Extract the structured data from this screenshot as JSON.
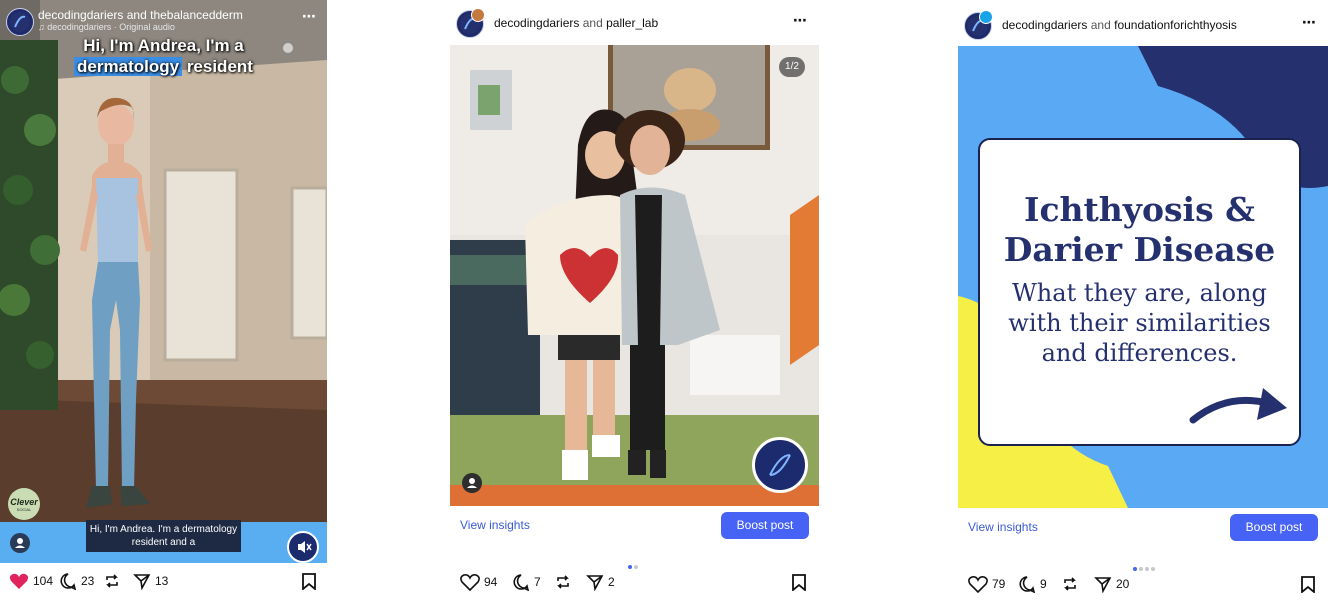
{
  "posts": [
    {
      "author": "decodingdariers",
      "conj": "and",
      "collaborator": "thebalancedderm",
      "audio": "decodingdariers · Original audio",
      "caption_line1": "Hi, I'm Andrea, I'm a",
      "caption_highlight": "dermatology",
      "caption_line2_rest": "resident",
      "subtitle": "Hi, I'm Andrea. I'm a dermatology resident and a",
      "sticker_text": "Clever",
      "sticker_sub": "SOCIAL",
      "likes": "104",
      "comments": "23",
      "shares": "13",
      "liked": true
    },
    {
      "author": "decodingdariers",
      "conj": "and",
      "collaborator": "paller_lab",
      "counter": "1/2",
      "view_insights": "View insights",
      "boost": "Boost post",
      "likes": "94",
      "comments": "7",
      "shares": "2"
    },
    {
      "author": "decodingdariers",
      "conj": "and",
      "collaborator": "foundationforichthyosis",
      "card_title_line1": "Ichthyosis &",
      "card_title_line2": "Darier Disease",
      "card_body_line1": "What they are, along",
      "card_body_line2": "with their similarities",
      "card_body_line3": "and differences.",
      "view_insights": "View insights",
      "boost": "Boost post",
      "likes": "79",
      "comments": "9",
      "shares": "20"
    }
  ],
  "icons": {
    "more": "⋯",
    "music": "♫"
  },
  "colors": {
    "accent": "#4763f5",
    "link": "#3b5bd6",
    "like_red": "#e0245e",
    "navy": "#25306e",
    "card_blue": "#5aa9f5",
    "card_yellow": "#f6ef45"
  }
}
